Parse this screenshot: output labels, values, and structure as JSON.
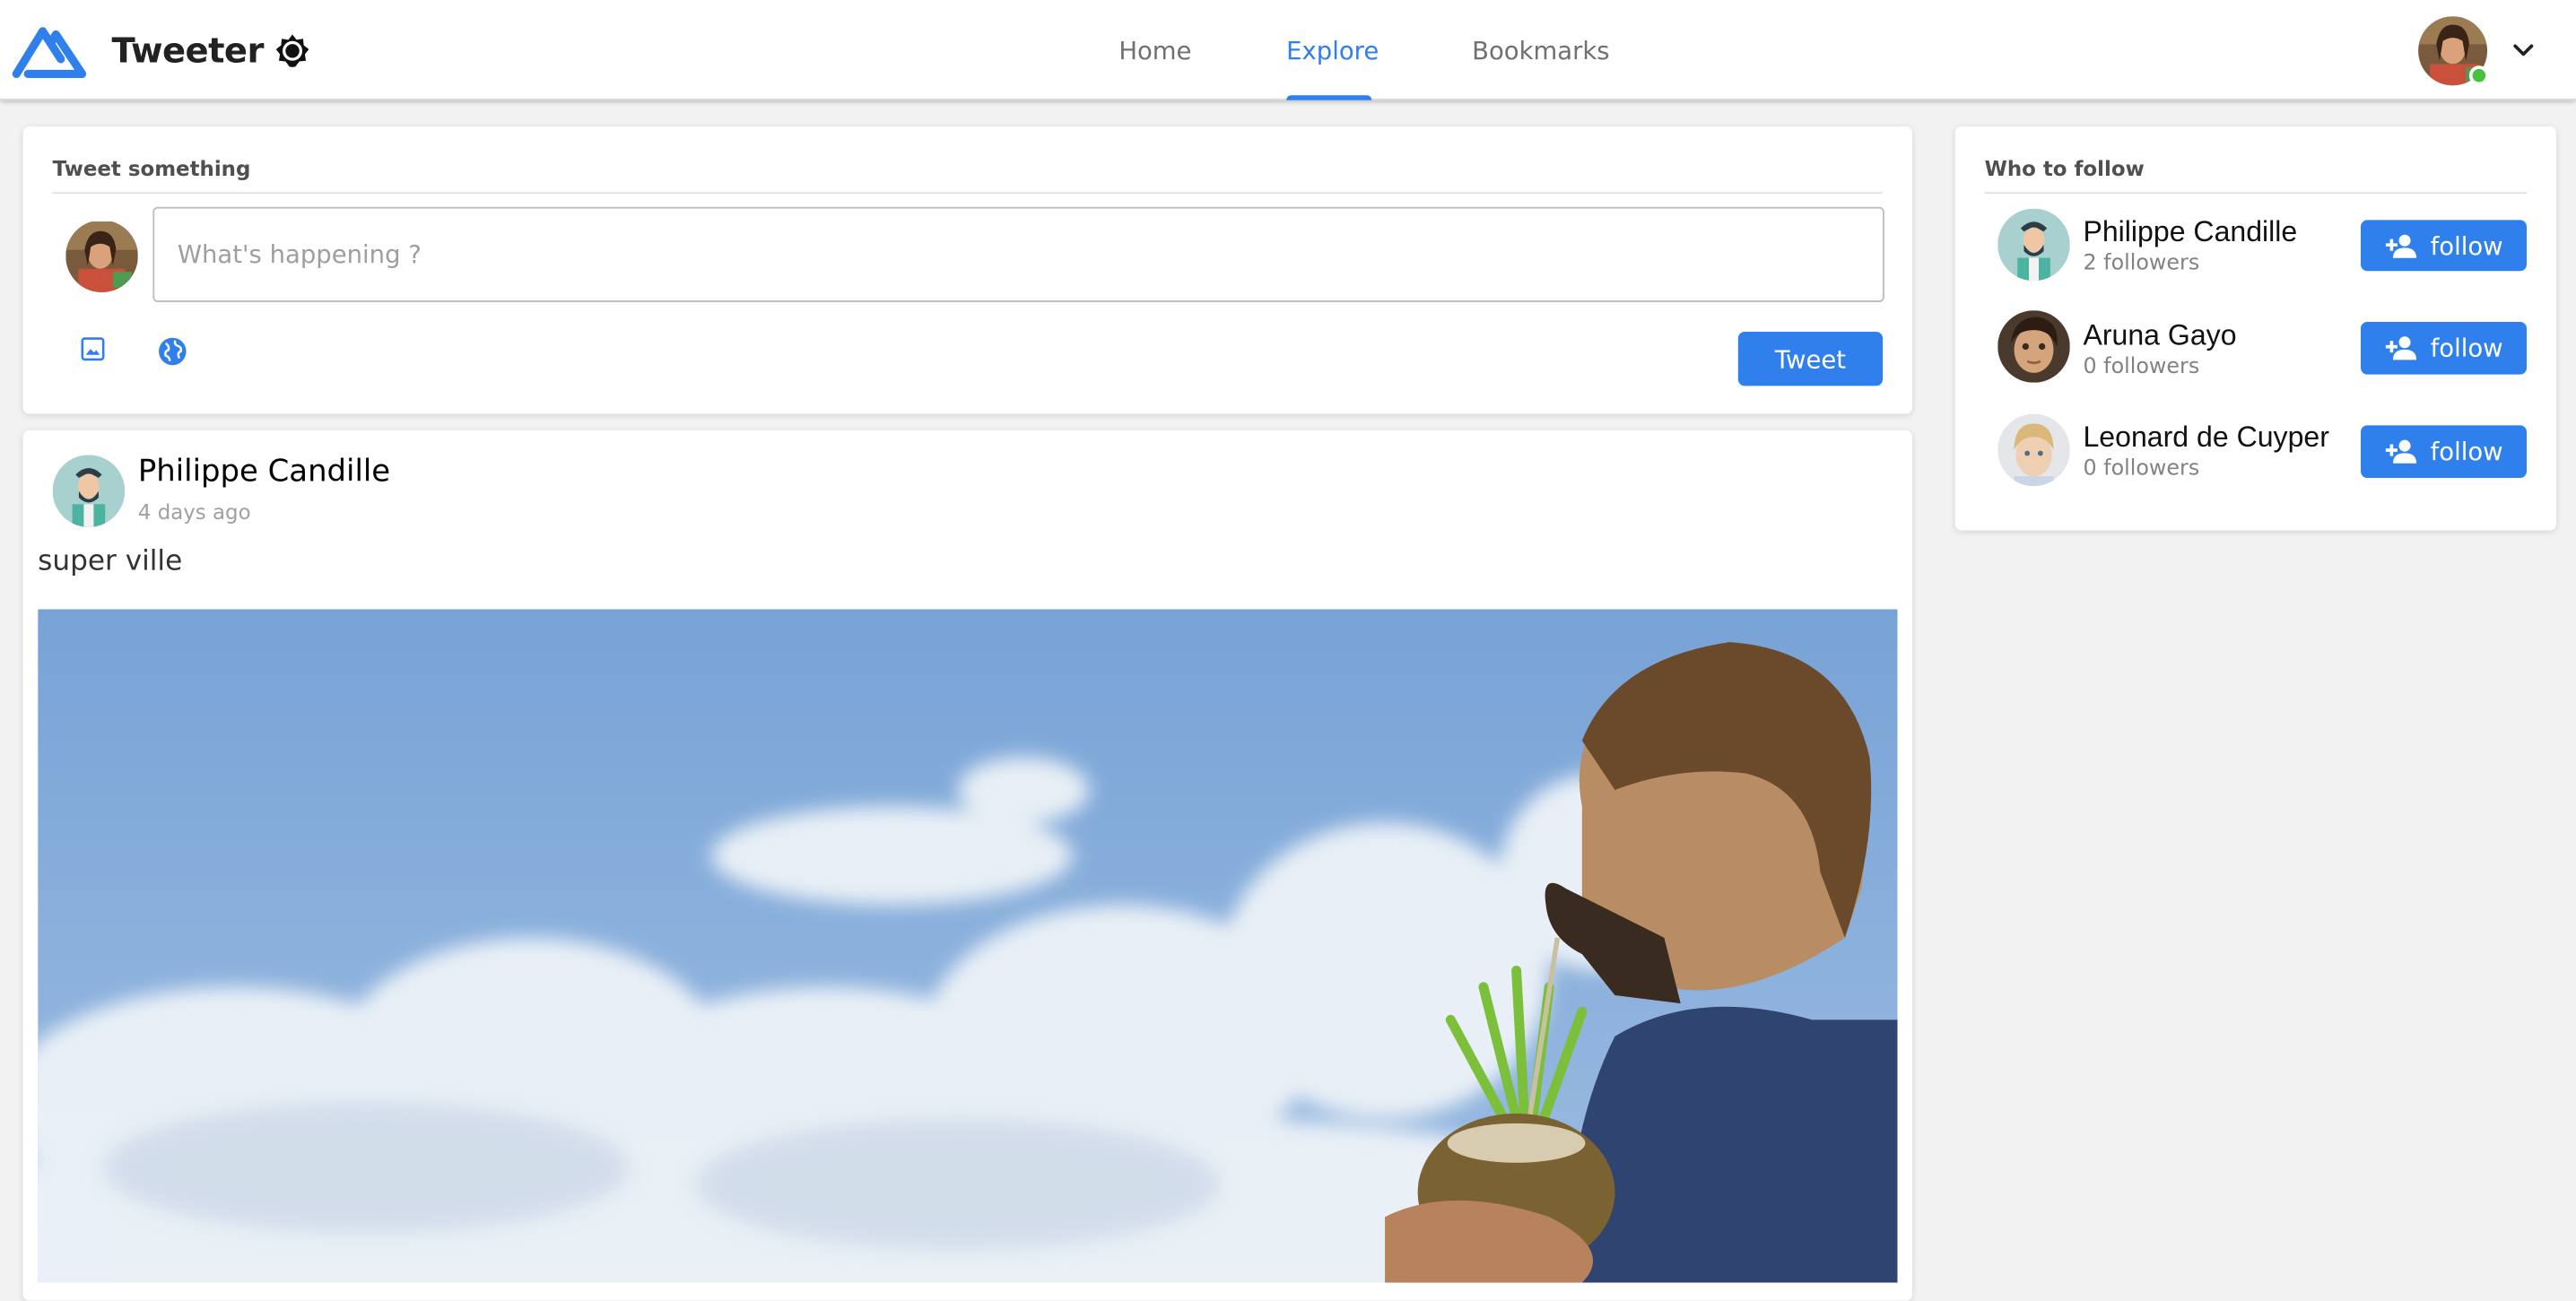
{
  "header": {
    "brand": "Tweeter",
    "nav": [
      {
        "label": "Home",
        "active": false
      },
      {
        "label": "Explore",
        "active": true
      },
      {
        "label": "Bookmarks",
        "active": false
      }
    ],
    "accent_color": "#2F80ED",
    "status_color": "#48c23e"
  },
  "compose": {
    "title": "Tweet something",
    "placeholder": "What's happening ?",
    "value": "",
    "submit_label": "Tweet",
    "icons": [
      "image-icon",
      "globe-icon"
    ]
  },
  "post": {
    "author": "Philippe Candille",
    "time": "4 days ago",
    "text": "super ville"
  },
  "who_to_follow": {
    "title": "Who to follow",
    "users": [
      {
        "name": "Philippe Candille",
        "followers": "2 followers",
        "button": "follow"
      },
      {
        "name": "Aruna Gayo",
        "followers": "0 followers",
        "button": "follow"
      },
      {
        "name": "Leonard de Cuyper",
        "followers": "0 followers",
        "button": "follow"
      }
    ]
  }
}
